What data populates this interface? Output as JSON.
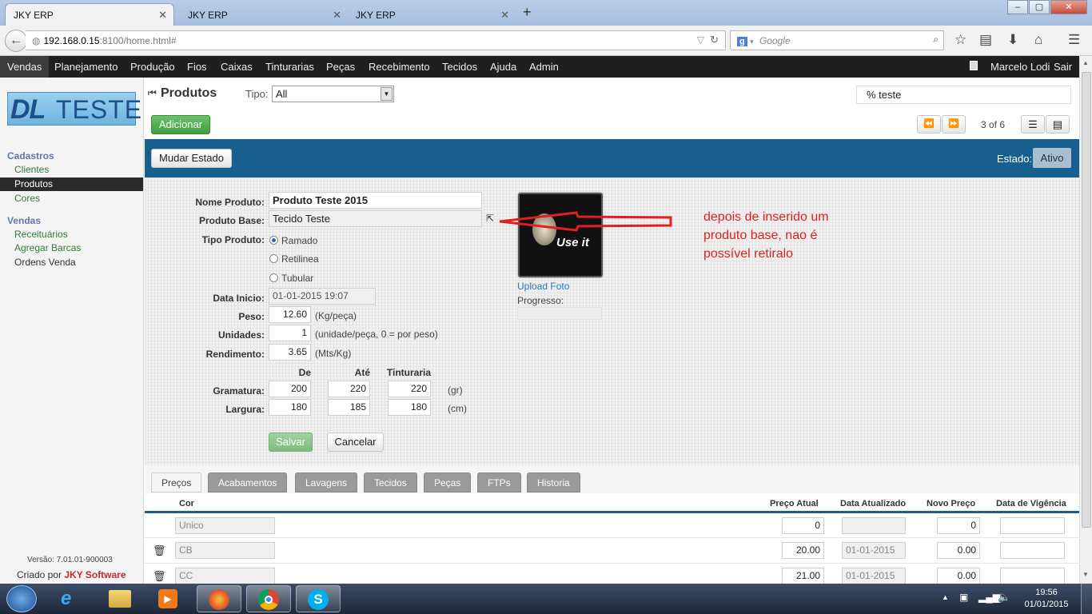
{
  "browser": {
    "tabs": [
      {
        "title": "JKY ERP",
        "active": true
      },
      {
        "title": "JKY ERP",
        "active": false
      },
      {
        "title": "JKY ERP",
        "active": false
      }
    ],
    "new_tab": "+",
    "url_host": "192.168.0.15",
    "url_rest": ":8100/home.html#",
    "search_placeholder": "Google",
    "window_buttons": [
      "–",
      "▢",
      "✕"
    ]
  },
  "app": {
    "menu": [
      "Vendas",
      "Planejamento",
      "Produção",
      "Fios",
      "Caixas",
      "Tinturarias",
      "Peças",
      "Recebimento",
      "Tecidos",
      "Ajuda",
      "Admin"
    ],
    "user": "Marcelo Lodi",
    "logout": "Sair"
  },
  "sidebar": {
    "logo_dl": "DL",
    "logo_teste": "TESTE",
    "group1": "Cadastros",
    "group1_items": [
      "Clientes",
      "Produtos",
      "Cores"
    ],
    "group2": "Vendas",
    "group2_items": [
      "Receituários",
      "Agregar Barcas",
      "Ordens Venda"
    ],
    "version": "Versão: 7.01.01-900003",
    "created_by": "Criado por",
    "company": "JKY Software"
  },
  "page": {
    "title": "Produtos",
    "tipo_label": "Tipo:",
    "tipo_value": "All",
    "filter_value": "% teste",
    "add_button": "Adicionar",
    "pager": "3 of 6",
    "change_state_button": "Mudar Estado",
    "estado_label": "Estado:",
    "estado_value": "Ativo"
  },
  "form": {
    "nome_label": "Nome Produto:",
    "nome_value": "Produto Teste 2015",
    "base_label": "Produto Base:",
    "base_value": "Tecido Teste",
    "tipo_label": "Tipo Produto:",
    "tipo_options": [
      "Ramado",
      "Retilinea",
      "Tubular"
    ],
    "tipo_selected": "Ramado",
    "data_label": "Data Inicio:",
    "data_value": "01-01-2015 19:07",
    "peso_label": "Peso:",
    "peso_value": "12.60",
    "peso_hint": "(Kg/peça)",
    "unid_label": "Unidades:",
    "unid_value": "1",
    "unid_hint": "(unidade/peça, 0 = por peso)",
    "rend_label": "Rendimento:",
    "rend_value": "3.65",
    "rend_hint": "(Mts/Kg)",
    "col_de": "De",
    "col_ate": "Até",
    "col_tint": "Tinturaria",
    "gram_label": "Gramatura:",
    "gram_de": "200",
    "gram_ate": "220",
    "gram_tint": "220",
    "gram_unit": "(gr)",
    "larg_label": "Largura:",
    "larg_de": "180",
    "larg_ate": "185",
    "larg_tint": "180",
    "larg_unit": "(cm)",
    "save_button": "Salvar",
    "cancel_button": "Cancelar",
    "photo_text": "Use it",
    "upload_link": "Upload Foto",
    "progress_label": "Progresso:"
  },
  "annotation": {
    "text_line1": "depois de inserido um",
    "text_line2": "produto base, nao é",
    "text_line3": "possível retiralo",
    "color": "#e02020"
  },
  "grid": {
    "tabs": [
      "Preços",
      "Acabamentos",
      "Lavagens",
      "Tecidos",
      "Peças",
      "FTPs",
      "Historia"
    ],
    "active_tab": "Preços",
    "headers": {
      "cor": "Cor",
      "preco_atual": "Preço Atual",
      "data_atualizado": "Data Atualizado",
      "novo_preco": "Novo Preço",
      "data_vigencia": "Data de Vigência"
    },
    "rows": [
      {
        "cor": "Unico",
        "preco_atual": "0",
        "data_atualizado": "",
        "novo_preco": "0",
        "data_vigencia": "",
        "deletable": false
      },
      {
        "cor": "CB",
        "preco_atual": "20.00",
        "data_atualizado": "01-01-2015",
        "novo_preco": "0.00",
        "data_vigencia": "",
        "deletable": true
      },
      {
        "cor": "CC",
        "preco_atual": "21.00",
        "data_atualizado": "01-01-2015",
        "novo_preco": "0.00",
        "data_vigencia": "",
        "deletable": true
      }
    ]
  },
  "taskbar": {
    "time": "19:56",
    "date": "01/01/2015"
  }
}
